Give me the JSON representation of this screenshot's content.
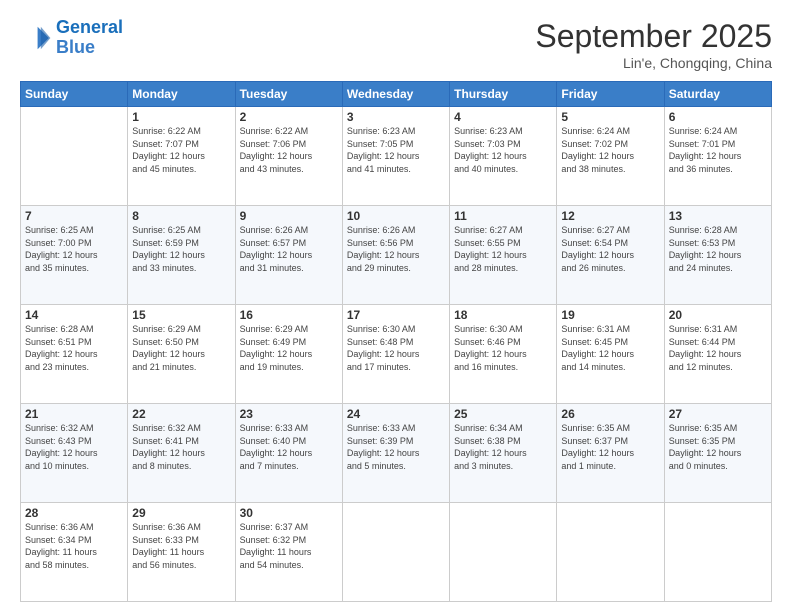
{
  "logo": {
    "line1": "General",
    "line2": "Blue"
  },
  "title": "September 2025",
  "subtitle": "Lin'e, Chongqing, China",
  "weekdays": [
    "Sunday",
    "Monday",
    "Tuesday",
    "Wednesday",
    "Thursday",
    "Friday",
    "Saturday"
  ],
  "weeks": [
    [
      {
        "day": "",
        "info": ""
      },
      {
        "day": "1",
        "info": "Sunrise: 6:22 AM\nSunset: 7:07 PM\nDaylight: 12 hours\nand 45 minutes."
      },
      {
        "day": "2",
        "info": "Sunrise: 6:22 AM\nSunset: 7:06 PM\nDaylight: 12 hours\nand 43 minutes."
      },
      {
        "day": "3",
        "info": "Sunrise: 6:23 AM\nSunset: 7:05 PM\nDaylight: 12 hours\nand 41 minutes."
      },
      {
        "day": "4",
        "info": "Sunrise: 6:23 AM\nSunset: 7:03 PM\nDaylight: 12 hours\nand 40 minutes."
      },
      {
        "day": "5",
        "info": "Sunrise: 6:24 AM\nSunset: 7:02 PM\nDaylight: 12 hours\nand 38 minutes."
      },
      {
        "day": "6",
        "info": "Sunrise: 6:24 AM\nSunset: 7:01 PM\nDaylight: 12 hours\nand 36 minutes."
      }
    ],
    [
      {
        "day": "7",
        "info": "Sunrise: 6:25 AM\nSunset: 7:00 PM\nDaylight: 12 hours\nand 35 minutes."
      },
      {
        "day": "8",
        "info": "Sunrise: 6:25 AM\nSunset: 6:59 PM\nDaylight: 12 hours\nand 33 minutes."
      },
      {
        "day": "9",
        "info": "Sunrise: 6:26 AM\nSunset: 6:57 PM\nDaylight: 12 hours\nand 31 minutes."
      },
      {
        "day": "10",
        "info": "Sunrise: 6:26 AM\nSunset: 6:56 PM\nDaylight: 12 hours\nand 29 minutes."
      },
      {
        "day": "11",
        "info": "Sunrise: 6:27 AM\nSunset: 6:55 PM\nDaylight: 12 hours\nand 28 minutes."
      },
      {
        "day": "12",
        "info": "Sunrise: 6:27 AM\nSunset: 6:54 PM\nDaylight: 12 hours\nand 26 minutes."
      },
      {
        "day": "13",
        "info": "Sunrise: 6:28 AM\nSunset: 6:53 PM\nDaylight: 12 hours\nand 24 minutes."
      }
    ],
    [
      {
        "day": "14",
        "info": "Sunrise: 6:28 AM\nSunset: 6:51 PM\nDaylight: 12 hours\nand 23 minutes."
      },
      {
        "day": "15",
        "info": "Sunrise: 6:29 AM\nSunset: 6:50 PM\nDaylight: 12 hours\nand 21 minutes."
      },
      {
        "day": "16",
        "info": "Sunrise: 6:29 AM\nSunset: 6:49 PM\nDaylight: 12 hours\nand 19 minutes."
      },
      {
        "day": "17",
        "info": "Sunrise: 6:30 AM\nSunset: 6:48 PM\nDaylight: 12 hours\nand 17 minutes."
      },
      {
        "day": "18",
        "info": "Sunrise: 6:30 AM\nSunset: 6:46 PM\nDaylight: 12 hours\nand 16 minutes."
      },
      {
        "day": "19",
        "info": "Sunrise: 6:31 AM\nSunset: 6:45 PM\nDaylight: 12 hours\nand 14 minutes."
      },
      {
        "day": "20",
        "info": "Sunrise: 6:31 AM\nSunset: 6:44 PM\nDaylight: 12 hours\nand 12 minutes."
      }
    ],
    [
      {
        "day": "21",
        "info": "Sunrise: 6:32 AM\nSunset: 6:43 PM\nDaylight: 12 hours\nand 10 minutes."
      },
      {
        "day": "22",
        "info": "Sunrise: 6:32 AM\nSunset: 6:41 PM\nDaylight: 12 hours\nand 8 minutes."
      },
      {
        "day": "23",
        "info": "Sunrise: 6:33 AM\nSunset: 6:40 PM\nDaylight: 12 hours\nand 7 minutes."
      },
      {
        "day": "24",
        "info": "Sunrise: 6:33 AM\nSunset: 6:39 PM\nDaylight: 12 hours\nand 5 minutes."
      },
      {
        "day": "25",
        "info": "Sunrise: 6:34 AM\nSunset: 6:38 PM\nDaylight: 12 hours\nand 3 minutes."
      },
      {
        "day": "26",
        "info": "Sunrise: 6:35 AM\nSunset: 6:37 PM\nDaylight: 12 hours\nand 1 minute."
      },
      {
        "day": "27",
        "info": "Sunrise: 6:35 AM\nSunset: 6:35 PM\nDaylight: 12 hours\nand 0 minutes."
      }
    ],
    [
      {
        "day": "28",
        "info": "Sunrise: 6:36 AM\nSunset: 6:34 PM\nDaylight: 11 hours\nand 58 minutes."
      },
      {
        "day": "29",
        "info": "Sunrise: 6:36 AM\nSunset: 6:33 PM\nDaylight: 11 hours\nand 56 minutes."
      },
      {
        "day": "30",
        "info": "Sunrise: 6:37 AM\nSunset: 6:32 PM\nDaylight: 11 hours\nand 54 minutes."
      },
      {
        "day": "",
        "info": ""
      },
      {
        "day": "",
        "info": ""
      },
      {
        "day": "",
        "info": ""
      },
      {
        "day": "",
        "info": ""
      }
    ]
  ]
}
